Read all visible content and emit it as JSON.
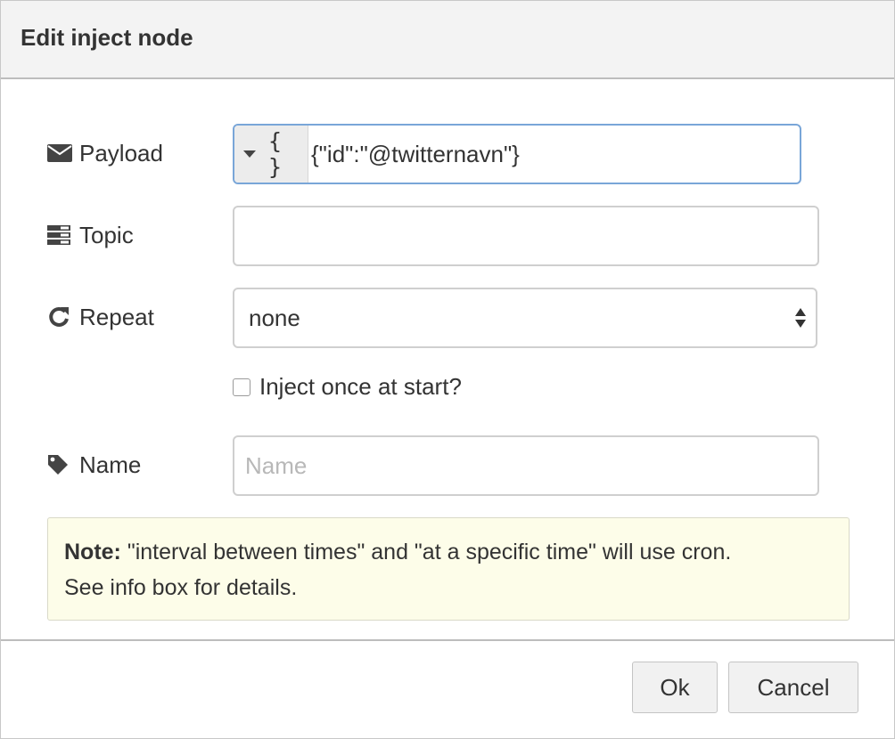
{
  "dialog": {
    "title": "Edit inject node"
  },
  "payload": {
    "label": "Payload",
    "icon": "envelope-icon",
    "type_glyph": "{ }",
    "value": "{\"id\":\"@twitternavn\"}"
  },
  "topic": {
    "label": "Topic",
    "icon": "tasks-icon",
    "value": ""
  },
  "repeat": {
    "label": "Repeat",
    "icon": "repeat-icon",
    "selected": "none"
  },
  "inject_once": {
    "label": "Inject once at start?",
    "checked": false
  },
  "name": {
    "label": "Name",
    "icon": "tag-icon",
    "placeholder": "Name"
  },
  "note": {
    "bold": "Note:",
    "line1": " \"interval between times\" and \"at a specific time\" will use cron.",
    "line2": "See info box for details."
  },
  "buttons": {
    "ok": "Ok",
    "cancel": "Cancel"
  },
  "colors": {
    "titlebar_bg": "#f3f3f3",
    "focus_border": "#79a6d8",
    "note_bg": "#fdfde9"
  }
}
